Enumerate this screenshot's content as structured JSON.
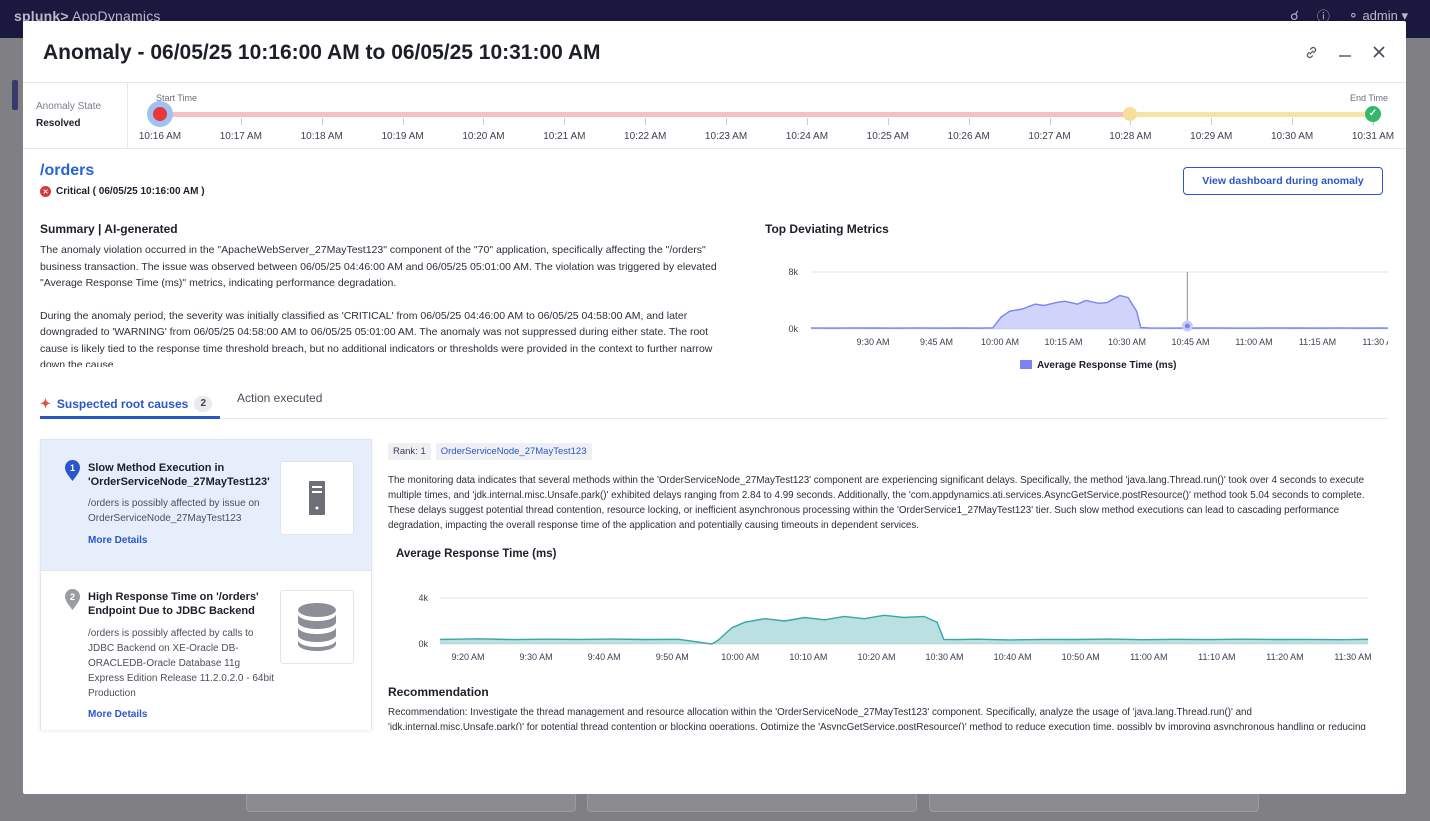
{
  "topbar": {
    "brand_logo": "splunk>",
    "brand_app": "AppDynamics",
    "user": "admin"
  },
  "modal": {
    "title": "Anomaly - 06/05/25 10:16:00 AM to 06/05/25 10:31:00 AM"
  },
  "timeline": {
    "state_label": "Anomaly State",
    "state_value": "Resolved",
    "start_label": "Start Time",
    "end_label": "End Time",
    "ticks": [
      "10:16 AM",
      "10:17 AM",
      "10:18 AM",
      "10:19 AM",
      "10:20 AM",
      "10:21 AM",
      "10:22 AM",
      "10:23 AM",
      "10:24 AM",
      "10:25 AM",
      "10:26 AM",
      "10:27 AM",
      "10:28 AM",
      "10:29 AM",
      "10:30 AM",
      "10:31 AM"
    ],
    "colors": {
      "critical": "#e8383f",
      "warning": "#f6df9a",
      "resolved": "#34b86a"
    }
  },
  "bt": {
    "name": "/orders",
    "severity": "Critical ( 06/05/25 10:16:00 AM )",
    "view_button": "View dashboard during anomaly"
  },
  "summary": {
    "title": "Summary | AI-generated",
    "p1": "The anomaly violation occurred in the \"ApacheWebServer_27MayTest123\" component of the \"70\" application, specifically affecting the \"/orders\" business transaction. The issue was observed between 06/05/25 04:46:00 AM and 06/05/25 05:01:00 AM. The violation was triggered by elevated \"Average Response Time (ms)\" metrics, indicating performance degradation.",
    "p2": "During the anomaly period, the severity was initially classified as 'CRITICAL' from 06/05/25 04:46:00 AM to 06/05/25 04:58:00 AM, and later downgraded to 'WARNING' from 06/05/25 04:58:00 AM to 06/05/25 05:01:00 AM. The anomaly was not suppressed during either state. The root cause is likely tied to the response time threshold breach, but no additional indicators or thresholds were provided in the context to further narrow down the cause."
  },
  "metrics": {
    "title": "Top Deviating Metrics",
    "legend": "Average Response Time (ms)"
  },
  "tabs": {
    "root_causes": "Suspected root causes",
    "root_causes_count": "2",
    "action": "Action executed"
  },
  "causes": [
    {
      "rank": "1",
      "title": "Slow Method Execution in 'OrderServiceNode_27MayTest123'",
      "desc": "/orders is possibly affected by issue on OrderServiceNode_27MayTest123",
      "more": "More Details",
      "icon": "server-icon"
    },
    {
      "rank": "2",
      "title": "High Response Time on '/orders' Endpoint Due to JDBC Backend",
      "desc": "/orders is possibly affected by calls to JDBC Backend on XE-Oracle DB-ORACLEDB-Oracle Database 11g Express Edition Release 11.2.0.2.0 - 64bit Production",
      "more": "More Details",
      "icon": "database-icon"
    }
  ],
  "detail": {
    "rank": "Rank: 1",
    "node": "OrderServiceNode_27MayTest123",
    "text": "The monitoring data indicates that several methods within the 'OrderServiceNode_27MayTest123' component are experiencing significant delays. Specifically, the method 'java.lang.Thread.run()' took over 4 seconds to execute multiple times, and 'jdk.internal.misc.Unsafe.park()' exhibited delays ranging from 2.84 to 4.99 seconds. Additionally, the 'com.appdynamics.ati.services.AsyncGetService.postResource()' method took 5.04 seconds to complete. These delays suggest potential thread contention, resource locking, or inefficient asynchronous processing within the 'OrderService1_27MayTest123' tier. Such slow method executions can lead to cascading performance degradation, impacting the overall response time of the application and potentially causing timeouts in dependent services.",
    "chart_title": "Average Response Time (ms)",
    "rec_title": "Recommendation",
    "rec_text": "Recommendation: Investigate the thread management and resource allocation within the 'OrderServiceNode_27MayTest123' component. Specifically, analyze the usage of 'java.lang.Thread.run()' and 'jdk.internal.misc.Unsafe.park()' for potential thread contention or blocking operations. Optimize the 'AsyncGetService.postResource()' method to reduce execution time, possibly by improving asynchronous handling or reducing external dependencies. Additionally, monitor thread pool configurations and adjust them to handle the observed load more efficiently."
  },
  "chart_data": [
    {
      "type": "area",
      "ylim": [
        0,
        8000
      ],
      "yticks": [
        "8k",
        "0k"
      ],
      "xticks": [
        "9:30 AM",
        "9:45 AM",
        "10:00 AM",
        "10:15 AM",
        "10:30 AM",
        "10:45 AM",
        "11:00 AM",
        "11:15 AM",
        "11:30 AM"
      ],
      "x_start_min": 555,
      "x_end_min": 695,
      "series": [
        {
          "name": "Average Response Time (ms)",
          "color": "#7b83f0",
          "x": [
            555,
            560,
            565,
            570,
            575,
            580,
            585,
            590,
            595,
            598,
            600,
            602,
            605,
            608,
            610,
            613,
            615,
            618,
            620,
            623,
            625,
            628,
            630,
            632,
            633,
            635,
            640,
            645,
            650,
            655,
            660,
            665,
            670,
            675,
            680,
            685,
            690,
            695
          ],
          "values": [
            150,
            120,
            160,
            140,
            130,
            150,
            120,
            140,
            130,
            170,
            1700,
            2500,
            2800,
            3500,
            3300,
            3700,
            3900,
            3500,
            4000,
            3600,
            3700,
            4700,
            4400,
            2500,
            200,
            150,
            120,
            140,
            160,
            130,
            120,
            150,
            140,
            130,
            160,
            120,
            140,
            130
          ]
        }
      ],
      "marker_x": 644,
      "legend": "bottom"
    },
    {
      "type": "area",
      "ylim": [
        0,
        4000
      ],
      "yticks": [
        "4k",
        "0k"
      ],
      "xticks": [
        "9:20 AM",
        "9:30 AM",
        "9:40 AM",
        "9:50 AM",
        "10:00 AM",
        "10:10 AM",
        "10:20 AM",
        "10:30 AM",
        "10:40 AM",
        "10:50 AM",
        "11:00 AM",
        "11:10 AM",
        "11:20 AM",
        "11:30 AM"
      ],
      "x_start_min": 554,
      "x_end_min": 694,
      "series": [
        {
          "name": "Average Response Time (ms)",
          "color": "#3aa6a8",
          "x": [
            554,
            560,
            565,
            570,
            575,
            580,
            585,
            590,
            595,
            596,
            598,
            600,
            603,
            606,
            609,
            612,
            615,
            618,
            621,
            624,
            627,
            629,
            630,
            632,
            635,
            640,
            645,
            650,
            655,
            660,
            665,
            670,
            675,
            680,
            685,
            690,
            694
          ],
          "values": [
            400,
            450,
            380,
            420,
            400,
            430,
            390,
            410,
            0,
            350,
            1400,
            1900,
            2200,
            2000,
            2300,
            2100,
            2400,
            2200,
            2500,
            2300,
            2400,
            1900,
            400,
            380,
            420,
            360,
            400,
            390,
            430,
            370,
            410,
            380,
            420,
            390,
            400,
            370,
            410
          ]
        }
      ]
    }
  ]
}
